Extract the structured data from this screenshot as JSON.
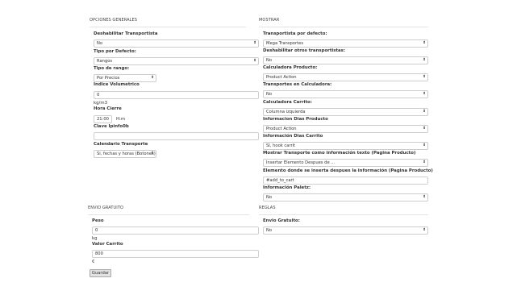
{
  "left": {
    "section_title": "OPCIONES GENERALES",
    "fields": {
      "deshabilitar": {
        "label": "Deshabilitar Transportista",
        "value": "No"
      },
      "tipo_defecto": {
        "label": "Tipo por Defecto:",
        "value": "Rangos"
      },
      "tipo_rango": {
        "label": "Tipo de rango:",
        "value": "Por Precios"
      },
      "indice": {
        "label": "Indice Volumetrico",
        "value": "0",
        "unit": "kg/m3"
      },
      "hora_cierre": {
        "label": "Hora Cierre",
        "value": "21:00",
        "unit": "H:m"
      },
      "clave": {
        "label": "Clave Ipinfo0b",
        "value": ""
      },
      "calendario": {
        "label": "Calendario Transporte",
        "value": "Si, fechas y horas (Botones)"
      }
    }
  },
  "right": {
    "section_title": "MOSTRAR",
    "fields": {
      "transportista_defecto": {
        "label": "Transportista por defecto:",
        "value": "Mega Transportes"
      },
      "deshabilitar_otros": {
        "label": "Deshabilitar otros transportistas:",
        "value": "No"
      },
      "calculadora_producto": {
        "label": "Calculadora Producto:",
        "value": "Product Action"
      },
      "transportes_calculadora": {
        "label": "Transportes en Calculadora:",
        "value": "No"
      },
      "calculadora_carrito": {
        "label": "Calculadora Carrito:",
        "value": "Columna izquierda"
      },
      "info_dias_producto": {
        "label": "Informacion Dias Producto",
        "value": "Product Action"
      },
      "info_dias_carrito": {
        "label": "Información Dias Carrito",
        "value": "SI, hook carrit"
      },
      "mostrar_transporte": {
        "label": "Mostrar Transporte como información texto (Pagina Producto)",
        "value": "Insertar Elemento Despues de ..."
      },
      "elemento_inserta": {
        "label": "Elemento donde se inserta despues la información (Pagina Producto)",
        "value": "#add_to_cart"
      },
      "info_paletz": {
        "label": "Información Paletz:",
        "value": "No"
      }
    }
  },
  "envio": {
    "section_title": "ENVIO GRATUITO",
    "fields": {
      "peso": {
        "label": "Peso",
        "value": "0",
        "unit": "kg"
      },
      "valor_carrito": {
        "label": "Valor Carrito",
        "value": "800",
        "unit": "€"
      }
    }
  },
  "reglas": {
    "section_title": "REGLAS",
    "fields": {
      "envio_gratuito": {
        "label": "Envio Gratuito:",
        "value": "No"
      }
    }
  },
  "save_button": {
    "label": "Guardar"
  },
  "icons": {
    "select_arrow": "select-arrows-icon"
  }
}
